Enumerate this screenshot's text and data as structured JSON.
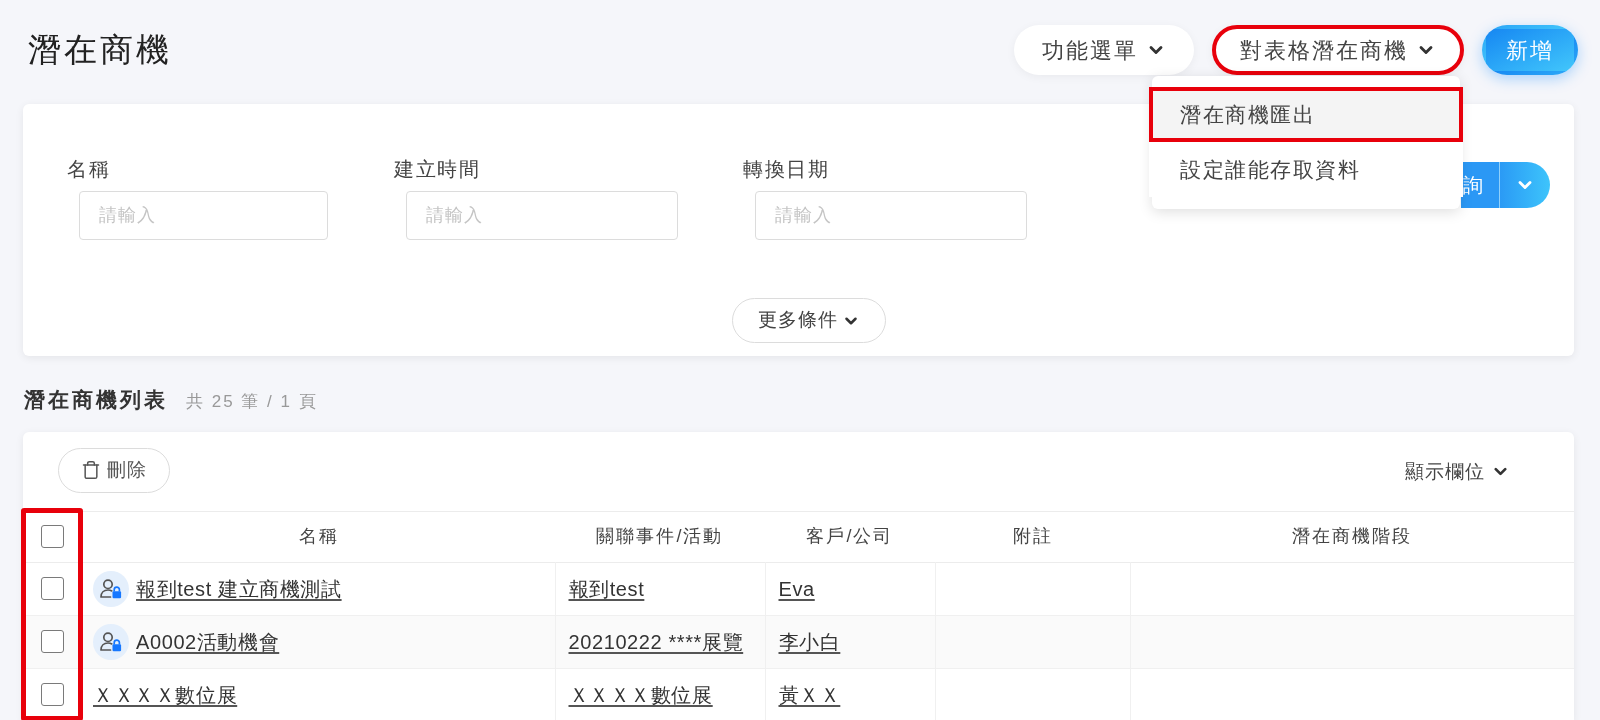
{
  "page": {
    "title": "潛在商機"
  },
  "toolbar": {
    "buttons": [
      {
        "kind": "menu",
        "label": "功能選單",
        "highlighted": false
      },
      {
        "kind": "menu",
        "label": "對表格潛在商機",
        "highlighted": true,
        "menu": {
          "items": [
            {
              "label": "潛在商機匯出",
              "highlighted": true
            },
            {
              "label": "設定誰能存取資料",
              "highlighted": false
            }
          ]
        }
      },
      {
        "kind": "primary",
        "label": "新增",
        "highlighted": false
      }
    ]
  },
  "filters": {
    "fields": [
      {
        "label": "名稱",
        "placeholder": "請輸入"
      },
      {
        "label": "建立時間",
        "placeholder": "請輸入"
      },
      {
        "label": "轉換日期",
        "placeholder": "請輸入"
      }
    ],
    "search_button": "詢",
    "more_button": "更多條件"
  },
  "list": {
    "title": "潛在商機列表",
    "summary": "共 25 筆 / 1 頁",
    "delete_button": "刪除",
    "columns_button": "顯示欄位"
  },
  "table": {
    "checkbox_column_highlighted": true,
    "select_all_checked": false,
    "columns": [
      "名稱",
      "關聯事件/活動",
      "客戶/公司",
      "附註",
      "潛在商機階段"
    ],
    "rows": [
      {
        "checked": false,
        "locked": true,
        "name": "報到test 建立商機測試",
        "event": "報到test",
        "customer": "Eva"
      },
      {
        "checked": false,
        "locked": true,
        "name": "A0002活動機會",
        "event": "20210222 ****展覽",
        "customer": "李小白"
      },
      {
        "checked": false,
        "locked": false,
        "name": "ＸＸＸＸ數位展",
        "event": "ＸＸＸＸ數位展",
        "customer": "黃ＸＸ"
      }
    ]
  }
}
